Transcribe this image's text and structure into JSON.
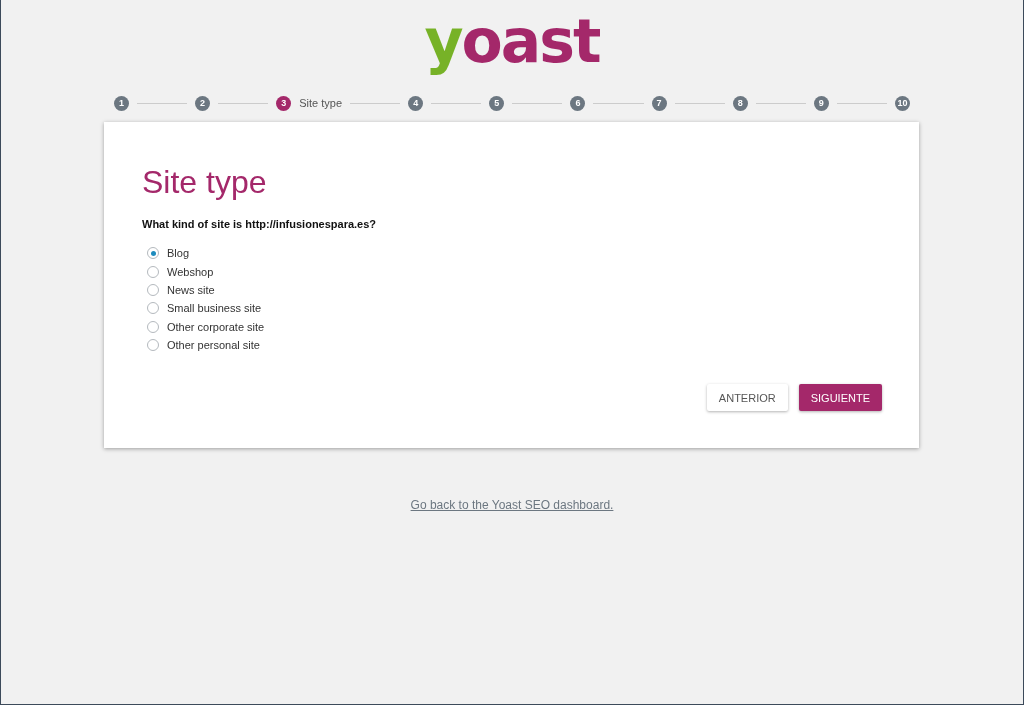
{
  "logo": {
    "text": "yoast"
  },
  "steps": [
    {
      "number": "1",
      "selected": false
    },
    {
      "number": "2",
      "selected": false
    },
    {
      "number": "3",
      "selected": true,
      "label": "Site type"
    },
    {
      "number": "4",
      "selected": false
    },
    {
      "number": "5",
      "selected": false
    },
    {
      "number": "6",
      "selected": false
    },
    {
      "number": "7",
      "selected": false
    },
    {
      "number": "8",
      "selected": false
    },
    {
      "number": "9",
      "selected": false
    },
    {
      "number": "10",
      "selected": false
    }
  ],
  "card": {
    "title": "Site type",
    "question": "What kind of site is http://infusionespara.es?",
    "options": [
      {
        "label": "Blog",
        "selected": true
      },
      {
        "label": "Webshop",
        "selected": false
      },
      {
        "label": "News site",
        "selected": false
      },
      {
        "label": "Small business site",
        "selected": false
      },
      {
        "label": "Other corporate site",
        "selected": false
      },
      {
        "label": "Other personal site",
        "selected": false
      }
    ],
    "buttons": [
      {
        "label": "ANTERIOR",
        "kind": "secondary"
      },
      {
        "label": "SIGUIENTE",
        "kind": "primary"
      }
    ]
  },
  "footer_link": "Go back to the Yoast SEO dashboard."
}
